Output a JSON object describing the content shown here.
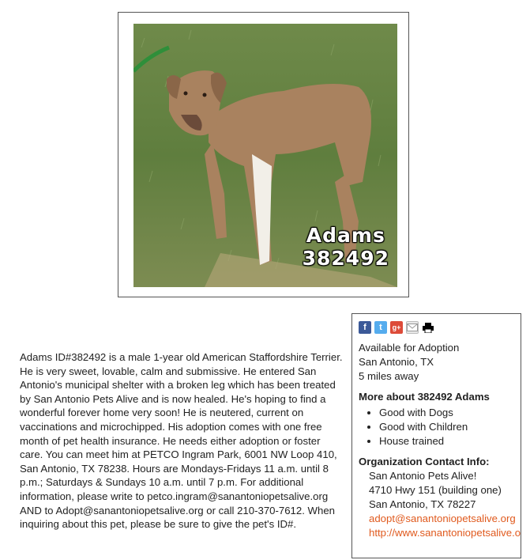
{
  "photo": {
    "caption_name": "Adams",
    "caption_id": "382492"
  },
  "description": "Adams ID#382492 is a male 1-year old American Staffordshire Terrier. He is very sweet, lovable, calm and submissive. He entered San Antonio's municipal shelter with a broken leg which has been treated by San Antonio Pets Alive and is now healed. He's hoping to find a wonderful forever home very soon! He is neutered, current on vaccinations and microchipped. His adoption comes with one free month of pet health insurance. He needs either adoption or foster care. You can meet him at PETCO Ingram Park, 6001 NW Loop 410, San Antonio, TX 78238. Hours are Mondays-Fridays 11 a.m. until 8 p.m.; Saturdays & Sundays 10 a.m. until 7 p.m. For additional information, please write to petco.ingram@sanantoniopetsalive.org AND to Adopt@sanantoniopetsalive.org or call 210-370-7612. When inquiring about this pet, please be sure to give the pet's ID#.",
  "share": {
    "icons": [
      "facebook-icon",
      "twitter-icon",
      "google-plus-icon",
      "email-icon",
      "print-icon"
    ],
    "facebook_glyph": "f",
    "twitter_glyph": "t",
    "google_glyph": "g+",
    "colors": {
      "facebook": "#3b5998",
      "twitter": "#55acee",
      "google": "#dd4b39",
      "link": "#e05a1e"
    }
  },
  "status": {
    "availability": "Available for Adoption",
    "location": "San Antonio, TX",
    "distance": "5 miles away"
  },
  "more": {
    "heading": "More about 382492 Adams",
    "traits": [
      "Good with Dogs",
      "Good with Children",
      "House trained"
    ]
  },
  "org": {
    "heading": "Organization Contact Info:",
    "name": "San Antonio Pets Alive!",
    "address1": "4710 Hwy 151 (building one)",
    "address2": "San Antonio, TX 78227",
    "email": "adopt@sanantoniopetsalive.org",
    "website": "http://www.sanantoniopetsalive.org"
  }
}
